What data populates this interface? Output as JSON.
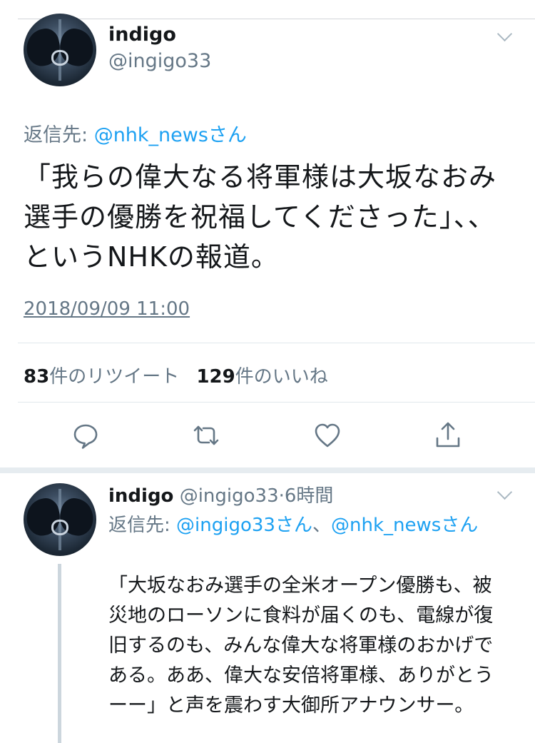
{
  "main_tweet": {
    "author_name": "indigo",
    "author_handle": "@ingigo33",
    "reply_prefix": "返信先: ",
    "reply_mention": "@nhk_newsさん",
    "text": "「我らの偉大なる将軍様は大坂なおみ選手の優勝を祝福してくださった」、、というNHKの報道。",
    "timestamp": "2018/09/09 11:00",
    "retweet_count": "83",
    "retweet_label": "件のリツイート",
    "like_count": "129",
    "like_label": "件のいいね",
    "actions": {
      "reply_icon": "reply-icon",
      "retweet_icon": "retweet-icon",
      "like_icon": "heart-icon",
      "share_icon": "share-icon"
    }
  },
  "reply_tweet": {
    "author_name": "indigo",
    "author_handle": "@ingigo33",
    "separator": "·",
    "time_ago": "6時間",
    "reply_prefix": "返信先: ",
    "reply_mention1": "@ingigo33さん",
    "reply_joiner": "、",
    "reply_mention2": "@nhk_newsさん",
    "text": "「大坂なおみ選手の全米オープン優勝も、被災地のローソンに食料が届くのも、電線が復旧するのも、みんな偉大な将軍様のおかげである。ああ、偉大な安倍将軍様、ありがとうーー」と声を震わす大御所アナウンサー。"
  },
  "colors": {
    "accent": "#1da1f2",
    "secondary_text": "#657786",
    "primary_text": "#14171a",
    "divider": "#e1e8ed"
  }
}
